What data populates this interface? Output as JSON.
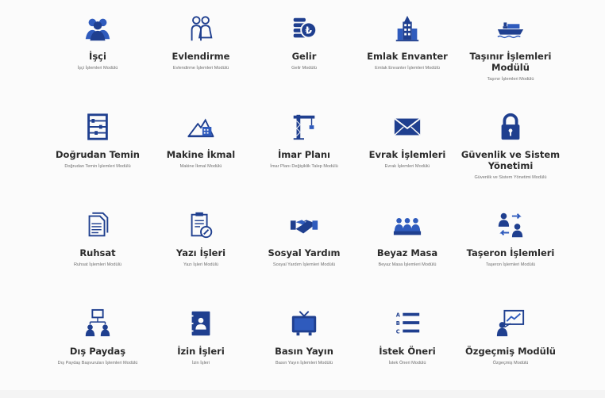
{
  "colors": {
    "icon": "#1f3f8f",
    "icon_light": "#2f5bbd",
    "title": "#2b2b2b",
    "subtitle": "#6f6f6f"
  },
  "modules": [
    {
      "icon": "workers-icon",
      "title": "İşçi",
      "subtitle": "İşçi İşlemleri Modülü"
    },
    {
      "icon": "couple-icon",
      "title": "Evlendirme",
      "subtitle": "Evlendirme İşlemleri Modülü"
    },
    {
      "icon": "coins-icon",
      "title": "Gelir",
      "subtitle": "Gelir Modülü"
    },
    {
      "icon": "building-icon",
      "title": "Emlak Envanter",
      "subtitle": "Emlak Envanter İşlemleri Modülü"
    },
    {
      "icon": "ship-icon",
      "title": "Taşınır İşlemleri Modülü",
      "subtitle": "Taşınır İşlemleri Modülü"
    },
    {
      "icon": "abacus-icon",
      "title": "Doğrudan Temin",
      "subtitle": "Doğrudan Temin İşlemleri Modülü"
    },
    {
      "icon": "factory-icon",
      "title": "Makine İkmal",
      "subtitle": "Makine İkmal Modülü"
    },
    {
      "icon": "crane-icon",
      "title": "İmar Planı",
      "subtitle": "İmar Planı Değişiklik Talep Modülü"
    },
    {
      "icon": "envelope-icon",
      "title": "Evrak İşlemleri",
      "subtitle": "Evrak İşlemleri Modülü"
    },
    {
      "icon": "lock-icon",
      "title": "Güvenlik ve Sistem Yönetimi",
      "subtitle": "Güvenlik ve Sistem Yönetimi Modülü"
    },
    {
      "icon": "documents-icon",
      "title": "Ruhsat",
      "subtitle": "Ruhsat İşlemleri Modülü"
    },
    {
      "icon": "writing-icon",
      "title": "Yazı İşleri",
      "subtitle": "Yazı İşleri Modülü"
    },
    {
      "icon": "handshake-icon",
      "title": "Sosyal Yardım",
      "subtitle": "Sosyal Yardım İşlemleri Modülü"
    },
    {
      "icon": "desk-people-icon",
      "title": "Beyaz Masa",
      "subtitle": "Beyaz Masa İşlemleri Modülü"
    },
    {
      "icon": "exchange-people-icon",
      "title": "Taşeron İşlemleri",
      "subtitle": "Taşeron İşlemleri Modülü"
    },
    {
      "icon": "org-chart-icon",
      "title": "Dış Paydaş",
      "subtitle": "Dış Paydaş Başvuruları İşlemleri Modülü"
    },
    {
      "icon": "contact-book-icon",
      "title": "İzin İşleri",
      "subtitle": "İzin İşleri"
    },
    {
      "icon": "television-icon",
      "title": "Basın Yayın",
      "subtitle": "Basın Yayın İşlemleri Modülü"
    },
    {
      "icon": "abc-list-icon",
      "title": "İstek Öneri",
      "subtitle": "İstek Öneri Modülü"
    },
    {
      "icon": "presentation-icon",
      "title": "Özgeçmiş Modülü",
      "subtitle": "Özgeçmiş Modülü"
    }
  ]
}
